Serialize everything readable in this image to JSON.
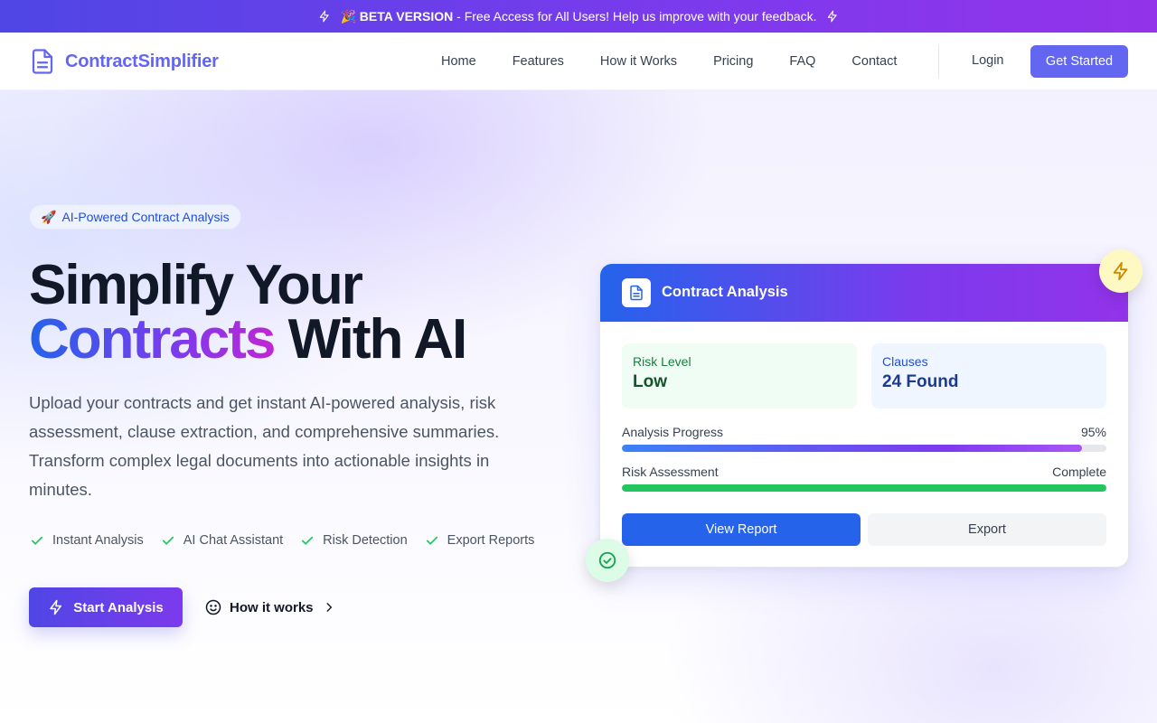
{
  "banner": {
    "emoji": "🎉",
    "bold": "BETA VERSION",
    "text": " - Free Access for All Users! Help us improve with your feedback."
  },
  "brand": {
    "name": "ContractSimplifier",
    "accent": "#6366f1"
  },
  "nav": {
    "links": [
      "Home",
      "Features",
      "How it Works",
      "Pricing",
      "FAQ",
      "Contact"
    ],
    "login": "Login",
    "cta": "Get Started"
  },
  "hero": {
    "pill_emoji": "🚀",
    "pill": "AI-Powered Contract Analysis",
    "title_line1": "Simplify Your",
    "title_highlight": "Contracts",
    "title_rest": " With AI",
    "lead": "Upload your contracts and get instant AI-powered analysis, risk assessment, clause extraction, and comprehensive summaries. Transform complex legal documents into actionable insights in minutes.",
    "features": [
      "Instant Analysis",
      "AI Chat Assistant",
      "Risk Detection",
      "Export Reports"
    ],
    "primary_cta": "Start Analysis",
    "secondary_cta": "How it works"
  },
  "card": {
    "title": "Contract Analysis",
    "risk_label": "Risk Level",
    "risk_value": "Low",
    "clauses_label": "Clauses",
    "clauses_value": "24 Found",
    "progress_label": "Analysis Progress",
    "progress_value": "95%",
    "progress_fraction": 0.95,
    "assessment_label": "Risk Assessment",
    "assessment_value": "Complete",
    "assessment_fraction": 1.0,
    "view_button": "View Report",
    "export_button": "Export"
  },
  "colors": {
    "primary": "#6366f1",
    "blue": "#2563eb",
    "purple": "#7c3aed",
    "success": "#22c55e"
  },
  "icons": {
    "banner": "lightning-icon",
    "logo": "document-icon",
    "feature": "check-icon",
    "primary_cta": "lightning-icon",
    "secondary_cta": "smile-icon",
    "float_top": "lightning-icon",
    "float_bottom": "check-circle-icon"
  }
}
